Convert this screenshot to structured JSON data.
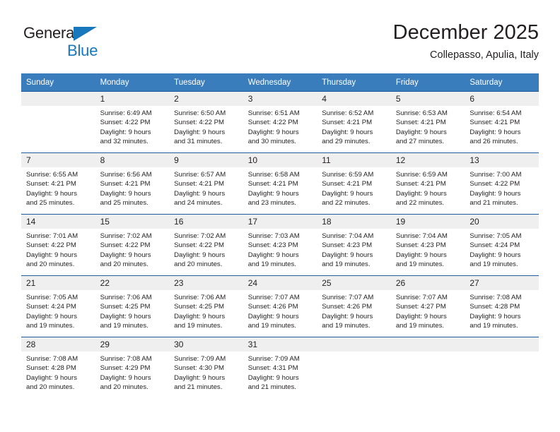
{
  "brand": {
    "name_top": "General",
    "name_bottom": "Blue",
    "triangle_color": "#1878be",
    "text_color": "#231f20"
  },
  "header": {
    "title": "December 2025",
    "subtitle": "Collepasso, Apulia, Italy"
  },
  "theme": {
    "header_bg": "#3a7dbd",
    "header_text": "#ffffff",
    "week_separator": "#1f5c9e",
    "daynum_bg": "#efefef",
    "body_text": "#231f20"
  },
  "weekdays": [
    "Sunday",
    "Monday",
    "Tuesday",
    "Wednesday",
    "Thursday",
    "Friday",
    "Saturday"
  ],
  "weeks": [
    {
      "days": [
        {
          "num": "",
          "sunrise": "",
          "sunset": "",
          "daylight1": "",
          "daylight2": ""
        },
        {
          "num": "1",
          "sunrise": "Sunrise: 6:49 AM",
          "sunset": "Sunset: 4:22 PM",
          "daylight1": "Daylight: 9 hours",
          "daylight2": "and 32 minutes."
        },
        {
          "num": "2",
          "sunrise": "Sunrise: 6:50 AM",
          "sunset": "Sunset: 4:22 PM",
          "daylight1": "Daylight: 9 hours",
          "daylight2": "and 31 minutes."
        },
        {
          "num": "3",
          "sunrise": "Sunrise: 6:51 AM",
          "sunset": "Sunset: 4:22 PM",
          "daylight1": "Daylight: 9 hours",
          "daylight2": "and 30 minutes."
        },
        {
          "num": "4",
          "sunrise": "Sunrise: 6:52 AM",
          "sunset": "Sunset: 4:21 PM",
          "daylight1": "Daylight: 9 hours",
          "daylight2": "and 29 minutes."
        },
        {
          "num": "5",
          "sunrise": "Sunrise: 6:53 AM",
          "sunset": "Sunset: 4:21 PM",
          "daylight1": "Daylight: 9 hours",
          "daylight2": "and 27 minutes."
        },
        {
          "num": "6",
          "sunrise": "Sunrise: 6:54 AM",
          "sunset": "Sunset: 4:21 PM",
          "daylight1": "Daylight: 9 hours",
          "daylight2": "and 26 minutes."
        }
      ]
    },
    {
      "days": [
        {
          "num": "7",
          "sunrise": "Sunrise: 6:55 AM",
          "sunset": "Sunset: 4:21 PM",
          "daylight1": "Daylight: 9 hours",
          "daylight2": "and 25 minutes."
        },
        {
          "num": "8",
          "sunrise": "Sunrise: 6:56 AM",
          "sunset": "Sunset: 4:21 PM",
          "daylight1": "Daylight: 9 hours",
          "daylight2": "and 25 minutes."
        },
        {
          "num": "9",
          "sunrise": "Sunrise: 6:57 AM",
          "sunset": "Sunset: 4:21 PM",
          "daylight1": "Daylight: 9 hours",
          "daylight2": "and 24 minutes."
        },
        {
          "num": "10",
          "sunrise": "Sunrise: 6:58 AM",
          "sunset": "Sunset: 4:21 PM",
          "daylight1": "Daylight: 9 hours",
          "daylight2": "and 23 minutes."
        },
        {
          "num": "11",
          "sunrise": "Sunrise: 6:59 AM",
          "sunset": "Sunset: 4:21 PM",
          "daylight1": "Daylight: 9 hours",
          "daylight2": "and 22 minutes."
        },
        {
          "num": "12",
          "sunrise": "Sunrise: 6:59 AM",
          "sunset": "Sunset: 4:21 PM",
          "daylight1": "Daylight: 9 hours",
          "daylight2": "and 22 minutes."
        },
        {
          "num": "13",
          "sunrise": "Sunrise: 7:00 AM",
          "sunset": "Sunset: 4:22 PM",
          "daylight1": "Daylight: 9 hours",
          "daylight2": "and 21 minutes."
        }
      ]
    },
    {
      "days": [
        {
          "num": "14",
          "sunrise": "Sunrise: 7:01 AM",
          "sunset": "Sunset: 4:22 PM",
          "daylight1": "Daylight: 9 hours",
          "daylight2": "and 20 minutes."
        },
        {
          "num": "15",
          "sunrise": "Sunrise: 7:02 AM",
          "sunset": "Sunset: 4:22 PM",
          "daylight1": "Daylight: 9 hours",
          "daylight2": "and 20 minutes."
        },
        {
          "num": "16",
          "sunrise": "Sunrise: 7:02 AM",
          "sunset": "Sunset: 4:22 PM",
          "daylight1": "Daylight: 9 hours",
          "daylight2": "and 20 minutes."
        },
        {
          "num": "17",
          "sunrise": "Sunrise: 7:03 AM",
          "sunset": "Sunset: 4:23 PM",
          "daylight1": "Daylight: 9 hours",
          "daylight2": "and 19 minutes."
        },
        {
          "num": "18",
          "sunrise": "Sunrise: 7:04 AM",
          "sunset": "Sunset: 4:23 PM",
          "daylight1": "Daylight: 9 hours",
          "daylight2": "and 19 minutes."
        },
        {
          "num": "19",
          "sunrise": "Sunrise: 7:04 AM",
          "sunset": "Sunset: 4:23 PM",
          "daylight1": "Daylight: 9 hours",
          "daylight2": "and 19 minutes."
        },
        {
          "num": "20",
          "sunrise": "Sunrise: 7:05 AM",
          "sunset": "Sunset: 4:24 PM",
          "daylight1": "Daylight: 9 hours",
          "daylight2": "and 19 minutes."
        }
      ]
    },
    {
      "days": [
        {
          "num": "21",
          "sunrise": "Sunrise: 7:05 AM",
          "sunset": "Sunset: 4:24 PM",
          "daylight1": "Daylight: 9 hours",
          "daylight2": "and 19 minutes."
        },
        {
          "num": "22",
          "sunrise": "Sunrise: 7:06 AM",
          "sunset": "Sunset: 4:25 PM",
          "daylight1": "Daylight: 9 hours",
          "daylight2": "and 19 minutes."
        },
        {
          "num": "23",
          "sunrise": "Sunrise: 7:06 AM",
          "sunset": "Sunset: 4:25 PM",
          "daylight1": "Daylight: 9 hours",
          "daylight2": "and 19 minutes."
        },
        {
          "num": "24",
          "sunrise": "Sunrise: 7:07 AM",
          "sunset": "Sunset: 4:26 PM",
          "daylight1": "Daylight: 9 hours",
          "daylight2": "and 19 minutes."
        },
        {
          "num": "25",
          "sunrise": "Sunrise: 7:07 AM",
          "sunset": "Sunset: 4:26 PM",
          "daylight1": "Daylight: 9 hours",
          "daylight2": "and 19 minutes."
        },
        {
          "num": "26",
          "sunrise": "Sunrise: 7:07 AM",
          "sunset": "Sunset: 4:27 PM",
          "daylight1": "Daylight: 9 hours",
          "daylight2": "and 19 minutes."
        },
        {
          "num": "27",
          "sunrise": "Sunrise: 7:08 AM",
          "sunset": "Sunset: 4:28 PM",
          "daylight1": "Daylight: 9 hours",
          "daylight2": "and 19 minutes."
        }
      ]
    },
    {
      "days": [
        {
          "num": "28",
          "sunrise": "Sunrise: 7:08 AM",
          "sunset": "Sunset: 4:28 PM",
          "daylight1": "Daylight: 9 hours",
          "daylight2": "and 20 minutes."
        },
        {
          "num": "29",
          "sunrise": "Sunrise: 7:08 AM",
          "sunset": "Sunset: 4:29 PM",
          "daylight1": "Daylight: 9 hours",
          "daylight2": "and 20 minutes."
        },
        {
          "num": "30",
          "sunrise": "Sunrise: 7:09 AM",
          "sunset": "Sunset: 4:30 PM",
          "daylight1": "Daylight: 9 hours",
          "daylight2": "and 21 minutes."
        },
        {
          "num": "31",
          "sunrise": "Sunrise: 7:09 AM",
          "sunset": "Sunset: 4:31 PM",
          "daylight1": "Daylight: 9 hours",
          "daylight2": "and 21 minutes."
        },
        {
          "num": "",
          "sunrise": "",
          "sunset": "",
          "daylight1": "",
          "daylight2": ""
        },
        {
          "num": "",
          "sunrise": "",
          "sunset": "",
          "daylight1": "",
          "daylight2": ""
        },
        {
          "num": "",
          "sunrise": "",
          "sunset": "",
          "daylight1": "",
          "daylight2": ""
        }
      ]
    }
  ]
}
